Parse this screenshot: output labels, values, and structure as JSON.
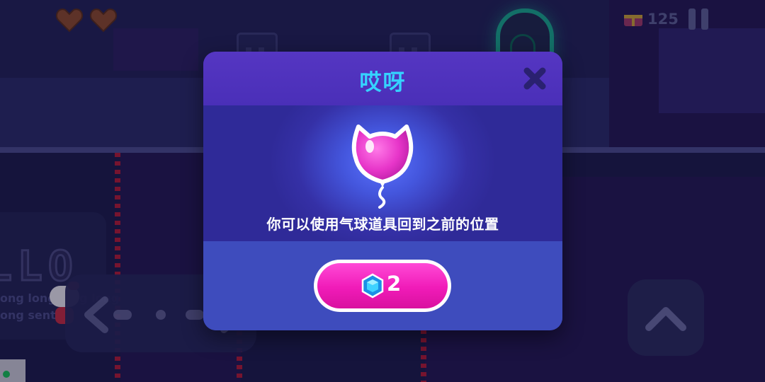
{
  "hud": {
    "hearts": 2,
    "coins": "125"
  },
  "level_sign": {
    "big_text": "LLO",
    "line1": "ong long long long",
    "line2": "ong sent"
  },
  "modal": {
    "title": "哎呀",
    "message": "你可以使用气球道具回到之前的位置",
    "button_cost": "2",
    "close_icon": "close-x-icon",
    "item_icon": "kitty-balloon-icon",
    "currency_icon": "blue-gem-icon"
  },
  "colors": {
    "title": "#35d2ff",
    "button": "#f01bb8",
    "modal_bg": "#3a2da8"
  }
}
